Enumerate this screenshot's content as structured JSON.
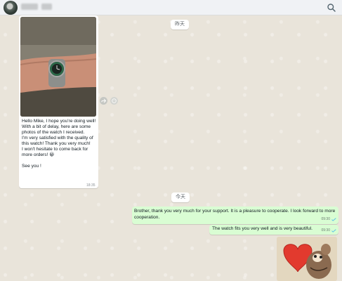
{
  "header": {
    "icons": {
      "search": "search-icon",
      "avatar": "avatar"
    }
  },
  "chat": {
    "date_yesterday": "昨天",
    "date_today": "今天",
    "incoming": {
      "text": "Hello Mike, I hope you're doing well!\nWith a bit of delay, here are some photos of the watch I received.\nI'm very satisfied with the quality of this watch! Thank you very much!\nI won't hesitate to come back for more orders! 😀\n\nSee you !",
      "time": "18:35"
    },
    "outgoing": [
      {
        "text": "Brother, thank you very much for your support. It is a pleasure to cooperate. I look forward to more cooperation.",
        "time": "09:30"
      },
      {
        "text": "The watch fits you very well and is very beautiful.",
        "time": "09:30"
      }
    ],
    "colors": {
      "outgoing_bubble": "#d9fdd3",
      "incoming_bubble": "#ffffff",
      "tick": "#53bdeb"
    }
  }
}
